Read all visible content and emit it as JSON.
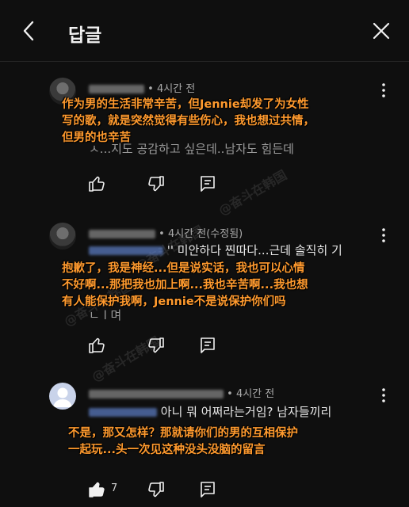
{
  "header": {
    "title": "답글"
  },
  "watermark": "@奋斗在韩国",
  "comments": [
    {
      "time": "• 4시간 전",
      "text_lines": [
        "ㅅ...지도 공감하고 싶은데..남자도 힘든데"
      ],
      "overlay_lines": [
        "作为男的生活非常辛苦，但Jennie却发了为女性",
        "写的歌，就是突然觉得有些伤心，我也想过共情，",
        "但男的也辛苦"
      ],
      "like_count": ""
    },
    {
      "time": "• 4시간 전(수정됨)",
      "text_lines": [
        "'' 미안하다 찐따다...근데 솔직히 기",
        "ㄴ l 며"
      ],
      "overlay_lines": [
        "抱歉了，我是神经...但是说实话，我也可以心情",
        "不好啊...那把我也加上啊...我也辛苦啊...我也想",
        "有人能保护我啊，Jennie不是说保护你们吗"
      ],
      "like_count": ""
    },
    {
      "time": "• 4시간 전",
      "text_lines": [
        "아니 뭐 어쩌라는거임? 남자들끼리"
      ],
      "overlay_lines": [
        "不是，那又怎样？那就请你们的男的互相保护",
        "一起玩...头一次见这种没头没脑的留言"
      ],
      "like_count": "7"
    }
  ]
}
